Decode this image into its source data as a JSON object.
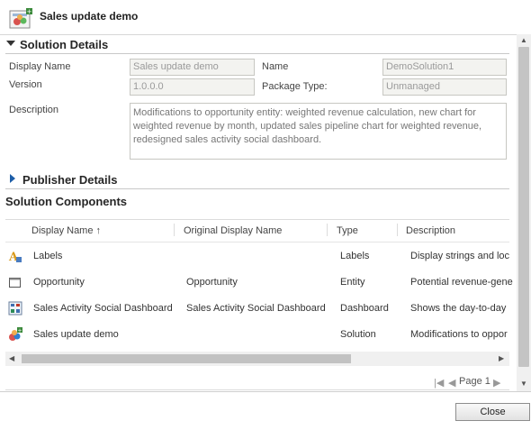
{
  "header": {
    "title": "Sales update demo",
    "icon": "solution-icon"
  },
  "solution_details": {
    "title": "Solution Details",
    "display_name_label": "Display Name",
    "display_name_value": "Sales update demo",
    "name_label": "Name",
    "name_value": "DemoSolution1",
    "version_label": "Version",
    "version_value": "1.0.0.0",
    "package_type_label": "Package Type:",
    "package_type_value": "Unmanaged",
    "description_label": "Description",
    "description_value": "Modifications to opportunity entity: weighted revenue calculation, new chart for weighted revenue by month, updated sales pipeline chart for weighted revenue, redesigned sales activity social dashboard."
  },
  "publisher_details": {
    "title": "Publisher Details"
  },
  "components": {
    "title": "Solution Components",
    "columns": [
      "Display Name",
      "Original Display Name",
      "Type",
      "Description"
    ],
    "sort_indicator": "↑",
    "rows": [
      {
        "display_name": "Labels",
        "original_display_name": "",
        "type": "Labels",
        "description": "Display strings and loc",
        "icon": "labels-icon"
      },
      {
        "display_name": "Opportunity",
        "original_display_name": "Opportunity",
        "type": "Entity",
        "description": "Potential revenue-gene",
        "icon": "entity-icon"
      },
      {
        "display_name": "Sales Activity Social Dashboard",
        "original_display_name": "Sales Activity Social Dashboard",
        "type": "Dashboard",
        "description": "Shows the day-to-day",
        "icon": "dashboard-icon"
      },
      {
        "display_name": "Sales update demo",
        "original_display_name": "",
        "type": "Solution",
        "description": "Modifications to oppor",
        "icon": "solution-icon"
      }
    ]
  },
  "pager": {
    "label": "Page 1"
  },
  "footer": {
    "close_label": "Close"
  }
}
